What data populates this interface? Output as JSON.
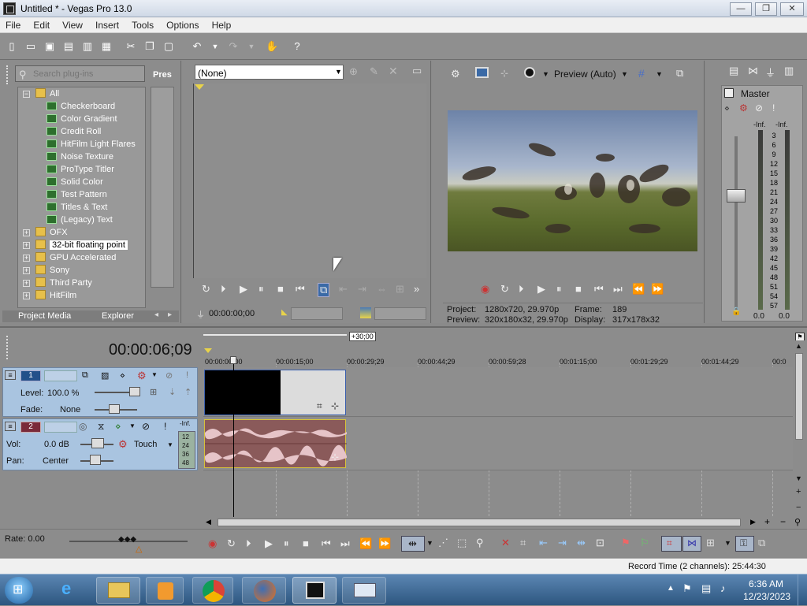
{
  "window": {
    "title": "Untitled * - Vegas Pro 13.0",
    "buttons": [
      "—",
      "❐",
      "✕"
    ]
  },
  "menu": [
    "File",
    "Edit",
    "View",
    "Insert",
    "Tools",
    "Options",
    "Help"
  ],
  "plugins": {
    "search_placeholder": "Search plug-ins",
    "presets_label": "Pres",
    "tree": [
      {
        "label": "All",
        "type": "folder-open"
      },
      {
        "label": "Checkerboard",
        "type": "fx"
      },
      {
        "label": "Color Gradient",
        "type": "fx"
      },
      {
        "label": "Credit Roll",
        "type": "fx"
      },
      {
        "label": "HitFilm Light Flares",
        "type": "fx"
      },
      {
        "label": "Noise Texture",
        "type": "fx"
      },
      {
        "label": "ProType Titler",
        "type": "fx"
      },
      {
        "label": "Solid Color",
        "type": "fx"
      },
      {
        "label": "Test Pattern",
        "type": "fx"
      },
      {
        "label": "Titles & Text",
        "type": "fx"
      },
      {
        "label": "(Legacy) Text",
        "type": "fx"
      },
      {
        "label": "OFX",
        "type": "folder"
      },
      {
        "label": "32-bit floating point",
        "type": "folder",
        "selected": true
      },
      {
        "label": "GPU Accelerated",
        "type": "folder"
      },
      {
        "label": "Sony",
        "type": "folder"
      },
      {
        "label": "Third Party",
        "type": "folder"
      },
      {
        "label": "HitFilm",
        "type": "folder"
      }
    ],
    "tabs": [
      "Project Media",
      "Explorer"
    ]
  },
  "trimmer": {
    "select_value": "(None)",
    "timecode": "00:00:00;00"
  },
  "preview": {
    "mode_label": "Preview (Auto)",
    "project_label": "Project:",
    "project_value": "1280x720, 29.970p",
    "preview_label": "Preview:",
    "preview_value": "320x180x32, 29.970p",
    "frame_label": "Frame:",
    "frame_value": "189",
    "display_label": "Display:",
    "display_value": "317x178x32"
  },
  "master": {
    "title": "Master",
    "inf_left": "-Inf.",
    "inf_right": "-Inf.",
    "scale": [
      "3",
      "6",
      "9",
      "12",
      "15",
      "18",
      "21",
      "24",
      "27",
      "30",
      "33",
      "36",
      "39",
      "42",
      "45",
      "48",
      "51",
      "54",
      "57"
    ],
    "bottom_left": "0.0",
    "bottom_right": "0.0"
  },
  "timeline": {
    "cursor_time": "00:00:06;09",
    "loop_label": "+30;00",
    "ruler": [
      "00:00:00;00",
      "00:00:15;00",
      "00:00:29;29",
      "00:00:44;29",
      "00:00:59;28",
      "00:01:15;00",
      "00:01:29;29",
      "00:01:44;29",
      "00:0"
    ],
    "video_track": {
      "number": "1",
      "level_label": "Level:",
      "level_value": "100.0 %",
      "fade_label": "Fade:",
      "fade_value": "None"
    },
    "audio_track": {
      "number": "2",
      "inf": "-Inf.",
      "vol_label": "Vol:",
      "vol_value": "0.0 dB",
      "pan_label": "Pan:",
      "pan_value": "Center",
      "touch_label": "Touch",
      "meter": [
        "12",
        "24",
        "36",
        "48"
      ]
    },
    "rate_label": "Rate: 0.00"
  },
  "status": {
    "record_time": "Record Time (2 channels): 25:44:30"
  },
  "taskbar": {
    "time": "6:36 AM",
    "date": "12/23/2023"
  },
  "colors": {
    "accent": "#3b6aa6",
    "video_track": "#a9c4e0",
    "audio_clip": "#8a5a5a",
    "clip_border": "#d6c23a"
  }
}
